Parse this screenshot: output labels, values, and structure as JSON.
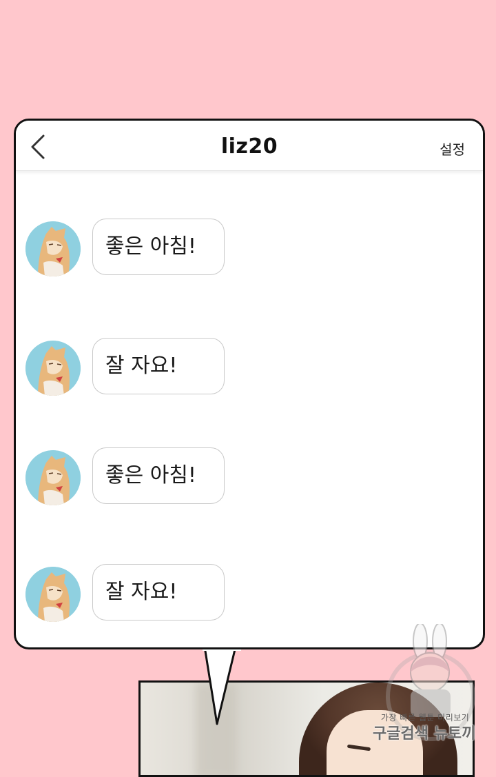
{
  "chat": {
    "title": "liz20",
    "settings_label": "설정",
    "back_icon": "chevron-left-icon",
    "messages": [
      {
        "text": "좋은 아침!",
        "avatar": "cat-avatar"
      },
      {
        "text": "잘 자요!",
        "avatar": "cat-avatar"
      },
      {
        "text": "좋은 아침!",
        "avatar": "cat-avatar"
      },
      {
        "text": "잘 자요!",
        "avatar": "cat-avatar"
      }
    ]
  },
  "watermark": {
    "line1": "가장 빠른 웹툰 미리보기",
    "line2": "구글검색 뉴토끼"
  },
  "colors": {
    "background": "#FFC7CC",
    "avatar_bg": "#8fd0e0",
    "bubble_border": "#c9c9c9"
  }
}
